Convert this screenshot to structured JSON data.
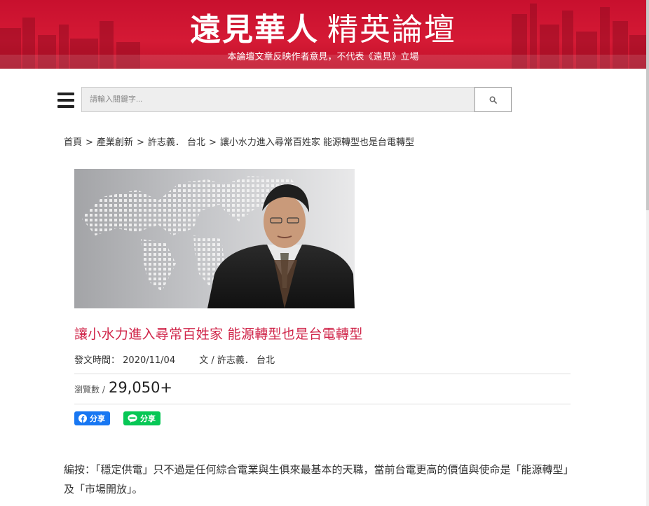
{
  "banner": {
    "title_bold": "遠見華人",
    "title_light": "精英論壇",
    "subtitle": "本論壇文章反映作者意見，不代表《遠見》立場"
  },
  "search": {
    "placeholder": "請輸入關鍵字..."
  },
  "breadcrumb": {
    "home": "首頁",
    "category": "產業創新",
    "author": "許志義． 台北",
    "current": "讓小水力進入尋常百姓家 能源轉型也是台電轉型",
    "separator": ">"
  },
  "article": {
    "title": "讓小水力進入尋常百姓家 能源轉型也是台電轉型",
    "published_label": "發文時間：",
    "published_date": "2020/11/04",
    "author_line": "文 / 許志義． 台北",
    "views_label": "瀏覽數 /",
    "views_count": "29,050+",
    "editor_note": "編按：「穩定供電」只不過是任何綜合電業與生俱來最基本的天職，當前台電更高的價值與使命是「能源轉型」及「市場開放」。"
  },
  "share": {
    "facebook_label": "分享",
    "line_label": "分享"
  },
  "colors": {
    "banner_red": "#c8102e",
    "title_pink": "#d0264a",
    "facebook_blue": "#1877f2",
    "line_green": "#06c755"
  },
  "icons": [
    "menu-icon",
    "search-icon",
    "facebook-icon",
    "line-icon"
  ]
}
